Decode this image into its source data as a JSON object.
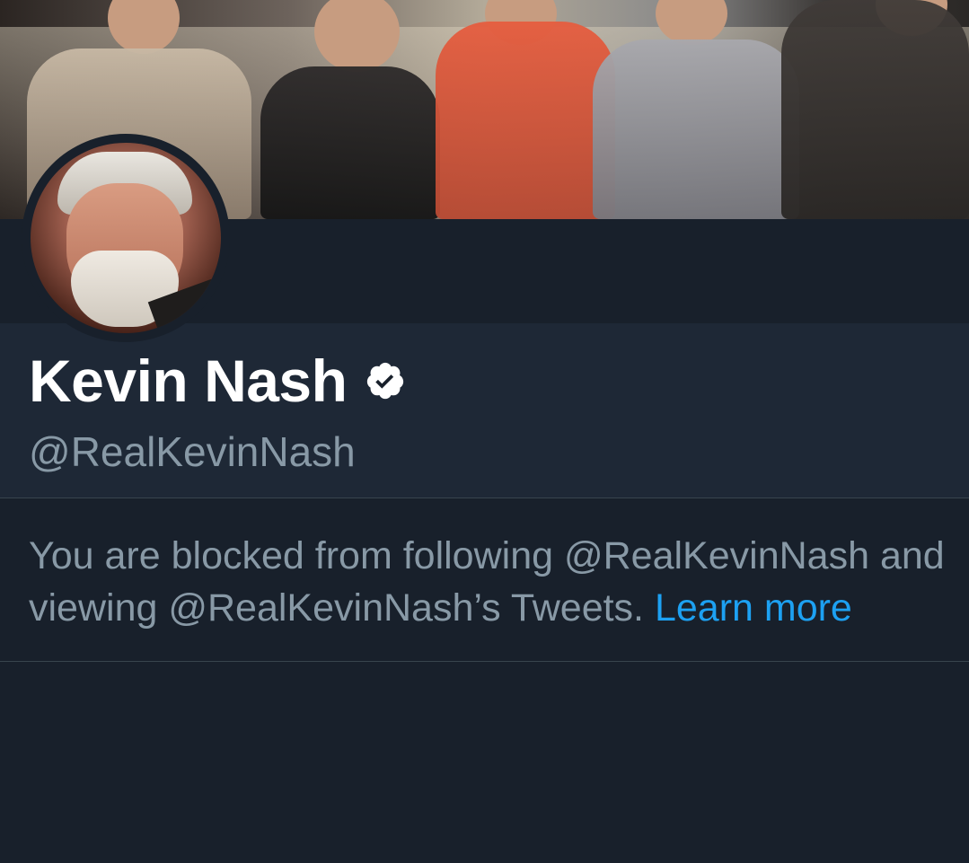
{
  "profile": {
    "display_name": "Kevin Nash",
    "handle": "@RealKevinNash",
    "verified": true,
    "verified_icon": "verified-badge-icon"
  },
  "blocked": {
    "message_prefix": "You are blocked from following @RealKevinNash and viewing @RealKevinNash’s Tweets. ",
    "learn_more_label": "Learn more"
  },
  "colors": {
    "background": "#18202b",
    "panel": "#1e2836",
    "divider": "#38444d",
    "secondary_text": "#8899a6",
    "link": "#1da1f2",
    "primary_text": "#ffffff"
  }
}
